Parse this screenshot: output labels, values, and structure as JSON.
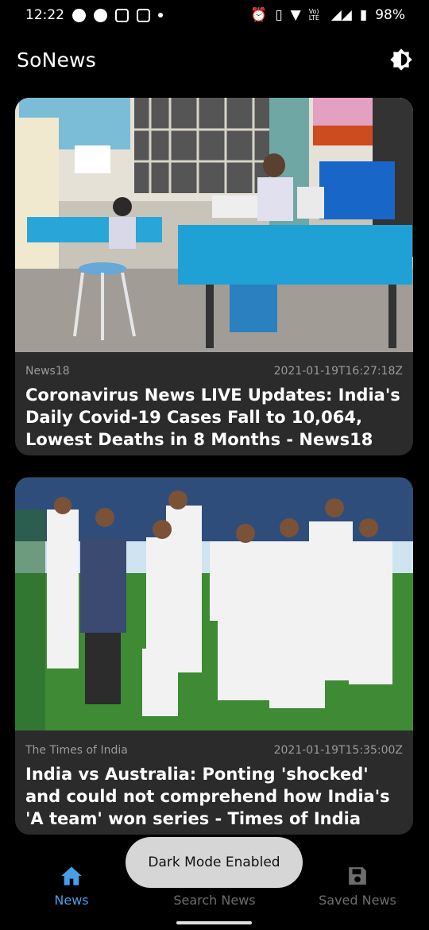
{
  "status_bar": {
    "time": "12:22",
    "network": "Vo) LTE",
    "battery": "98%"
  },
  "app": {
    "title": "SoNews"
  },
  "articles": [
    {
      "source": "News18",
      "timestamp": "2021-01-19T16:27:18Z",
      "title": "Coronavirus News LIVE Updates: India's Daily Covid-19 Cases Fall to 10,064, Lowest Deaths in 8 Months - News18"
    },
    {
      "source": "The Times of India",
      "timestamp": "2021-01-19T15:35:00Z",
      "title": "India vs Australia: Ponting 'shocked' and could not comprehend how India's 'A team' won series - Times of India"
    }
  ],
  "bottom_nav": {
    "items": [
      {
        "label": "News",
        "icon": "home-icon",
        "active": true
      },
      {
        "label": "Search News",
        "icon": "search-icon",
        "active": false
      },
      {
        "label": "Saved News",
        "icon": "save-icon",
        "active": false
      }
    ]
  },
  "toast": {
    "message": "Dark Mode Enabled"
  },
  "colors": {
    "accent": "#4a9ee8",
    "card_bg": "#2b2b2b",
    "background": "#000000"
  }
}
